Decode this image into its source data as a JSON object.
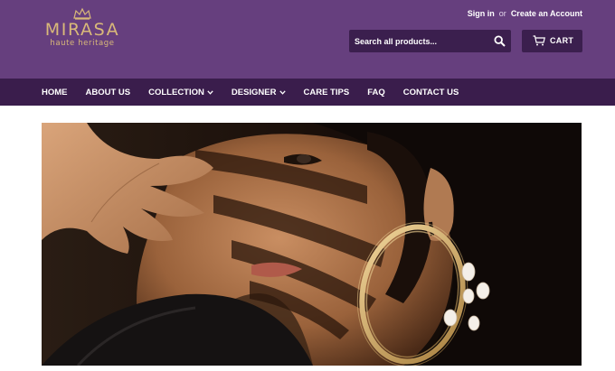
{
  "brand": {
    "name": "MIRASA",
    "tagline": "haute heritage"
  },
  "account": {
    "sign_in": "Sign in",
    "or": "or",
    "create": "Create an Account"
  },
  "search": {
    "placeholder": "Search all products..."
  },
  "cart": {
    "label": "CART"
  },
  "nav": {
    "items": [
      {
        "label": "HOME"
      },
      {
        "label": "ABOUT US"
      },
      {
        "label": "COLLECTION"
      },
      {
        "label": "DESIGNER"
      },
      {
        "label": "CARE TIPS"
      },
      {
        "label": "FAQ"
      },
      {
        "label": "CONTACT US"
      }
    ]
  },
  "colors": {
    "header": "#663f7e",
    "nav": "#3a1d4c",
    "input_bg": "#3b1f4e",
    "logo_gold": "#d9b979"
  },
  "icons": {
    "crown": "crown-icon",
    "search": "search-icon",
    "cart": "cart-icon",
    "dropdown": "chevron-down-icon"
  }
}
